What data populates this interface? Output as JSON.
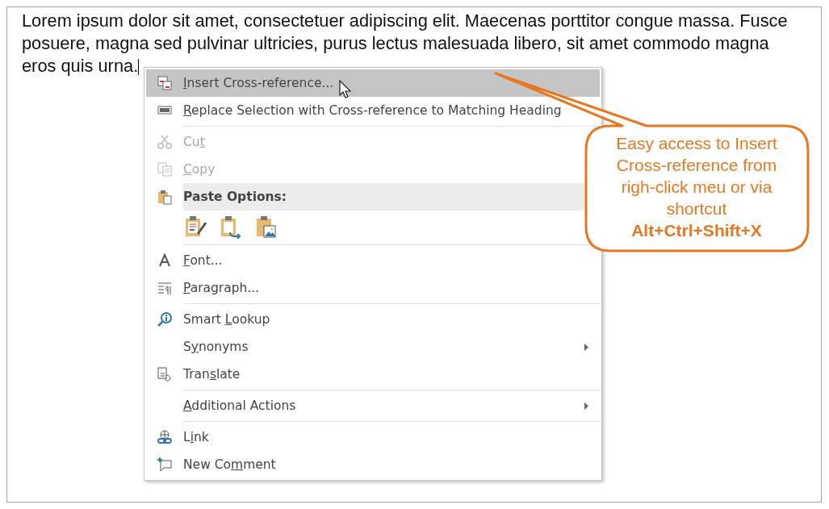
{
  "document": {
    "paragraph": "Lorem ipsum dolor sit amet, consectetuer adipiscing elit. Maecenas porttitor congue massa. Fusce posuere, magna sed pulvinar ultricies, purus lectus malesuada libero, sit amet commodo magna eros quis urna."
  },
  "context_menu": {
    "items": [
      {
        "kind": "item",
        "key": "I",
        "post": "nsert Cross-reference...",
        "selected": true,
        "disabled": false
      },
      {
        "kind": "item",
        "key": "R",
        "post": "eplace Selection with Cross-reference to Matching Heading",
        "selected": false,
        "disabled": false,
        "separator_after": true
      },
      {
        "kind": "item",
        "pre": "Cu",
        "key": "t",
        "selected": false,
        "disabled": true
      },
      {
        "kind": "item",
        "key": "C",
        "post": "opy",
        "selected": false,
        "disabled": true
      },
      {
        "kind": "header",
        "label": "Paste Options:"
      },
      {
        "kind": "paste-row",
        "separator_after": true
      },
      {
        "kind": "item",
        "key": "F",
        "post": "ont...",
        "selected": false,
        "disabled": false
      },
      {
        "kind": "item",
        "key": "P",
        "post": "aragraph...",
        "selected": false,
        "disabled": false,
        "separator_after": true
      },
      {
        "kind": "item",
        "pre": "Smart ",
        "key": "L",
        "post": "ookup",
        "selected": false,
        "disabled": false
      },
      {
        "kind": "item",
        "pre": "S",
        "key": "y",
        "post": "nonyms",
        "selected": false,
        "disabled": false,
        "submenu": true
      },
      {
        "kind": "item",
        "pre": "Tran",
        "key": "s",
        "post": "late",
        "selected": false,
        "disabled": false,
        "separator_after": true
      },
      {
        "kind": "item",
        "key": "A",
        "post": "dditional Actions",
        "selected": false,
        "disabled": false,
        "submenu": true,
        "separator_after": true
      },
      {
        "kind": "item",
        "pre": "L",
        "key": "i",
        "post": "nk",
        "selected": false,
        "disabled": false
      },
      {
        "kind": "item",
        "pre": "New Co",
        "key": "m",
        "post": "ment",
        "selected": false,
        "disabled": false
      }
    ]
  },
  "callout": {
    "text": "Easy access to Insert Cross-reference from righ-click meu or via shortcut",
    "shortcut": "Alt+Ctrl+Shift+X"
  }
}
